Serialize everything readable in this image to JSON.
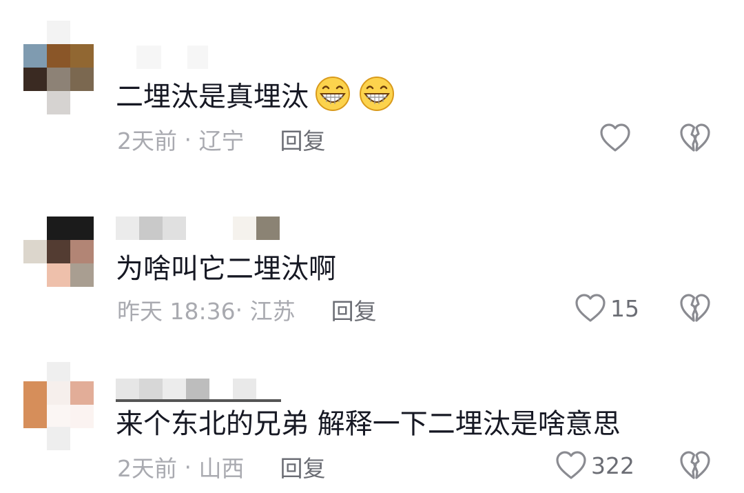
{
  "comments": [
    {
      "text": "二埋汰是真埋汰",
      "emoji": [
        "grinning-face-emoji",
        "grinning-face-emoji"
      ],
      "time": "2天前",
      "location": "辽宁",
      "reply_label": "回复",
      "likes": "",
      "avatar_pixelated": true,
      "username_pixelated": true
    },
    {
      "text": "为啥叫它二埋汰啊",
      "time": "昨天 18:36",
      "location": "江苏",
      "reply_label": "回复",
      "likes": "15",
      "avatar_pixelated": true,
      "username_pixelated": true
    },
    {
      "text": "来个东北的兄弟 解释一下二埋汰是啥意思",
      "time": "2天前",
      "location": "山西",
      "reply_label": "回复",
      "likes": "322",
      "avatar_pixelated": true,
      "username_pixelated": true
    }
  ],
  "icons": {
    "like": "heart-outline-icon",
    "dislike": "broken-heart-icon"
  },
  "colors": {
    "text": "#161823",
    "meta": "#a9aab0",
    "action": "#6b6d74",
    "icon": "#8a8b91"
  }
}
